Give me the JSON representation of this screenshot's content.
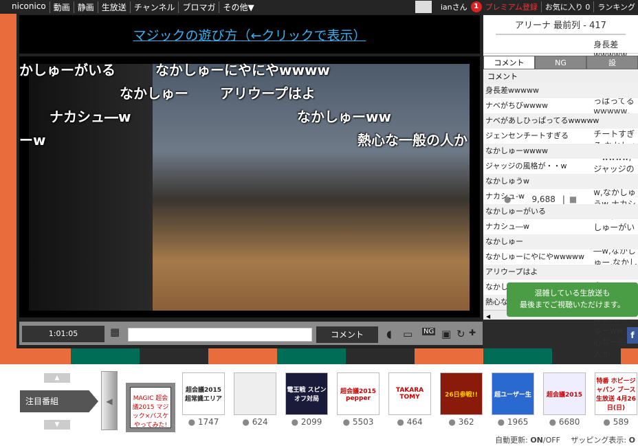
{
  "topbar": {
    "nav": [
      "niconico",
      "動画",
      "静画",
      "生放送",
      "チャンネル",
      "ブロマガ",
      "その他▼"
    ],
    "user": "ianさん",
    "notifications": "1",
    "premium": "プレミアム登録",
    "favorites": "お気に入り 0",
    "ranking": "ランキング"
  },
  "player": {
    "title_link": "マジックの遊び方（←クリックで表示）",
    "time": "1:01:05",
    "comment_placeholder": "",
    "comment_button": "コメント",
    "overlay_comments": [
      "かしゅーがいる",
      "なかしゅーにやにやwwww",
      "なかしゅー",
      "アリウープはよ",
      "ナカシュ―w",
      "なかしゅーww",
      "ーw",
      "熱心な一般の人か"
    ]
  },
  "side": {
    "seat": "アリーナ 最前列 - 417",
    "viewers": "9,688",
    "comments": [
      "身長差wwwww",
      "ナベがちびwwww",
      "ナベがあしひっぱってるwwwww",
      "ジェンセンチートすぎる",
      "なかしゅーwwww",
      "ジャッジの風格が・・w",
      "なかしゅうw",
      "ナカシュ-w",
      "なかしゅーがいる",
      "ナカシュ―w",
      "なかしゅー",
      "なかしゅーにやにやwwwww",
      "アリウープはよ",
      "なかしゅーww",
      "熱心な一般の人か"
    ],
    "tabs": [
      "コメント",
      "NG",
      "設"
    ],
    "list_header": "コメント",
    "toast": [
      "混雑している生放送も",
      "最後までご視聴いただけます。"
    ]
  },
  "colors": {
    "orange": "#e96d3c",
    "green": "#006e56",
    "dark": "#2b2b2b",
    "link": "#3ab0f0"
  },
  "bottom": {
    "featured_label": "注目番組",
    "selected_thumb": "MAGIC 超会議2015 マジック×バスケ やってみた!",
    "programs": [
      {
        "thumb": "超会議2015 超常識エリア",
        "count": "1747"
      },
      {
        "thumb": "",
        "count": "624"
      },
      {
        "thumb": "電王戦 スピンオフ対局",
        "count": "2099"
      },
      {
        "thumb": "超会議2015 pepper",
        "count": "5503"
      },
      {
        "thumb": "TAKARA TOMY",
        "count": "464"
      },
      {
        "thumb": "26日参戦!!",
        "count": "362"
      },
      {
        "thumb": "超ユーザー生",
        "count": "1965"
      },
      {
        "thumb": "超会議2015",
        "count": "6680"
      },
      {
        "thumb": "特番 ホビージャパン ブース生放送 4月26日(日)",
        "count": "589"
      }
    ],
    "auto_update_label": "自動更新:",
    "on": "ON",
    "off": "/OFF",
    "zapping_label": "ザッピング表示:",
    "zapping_value": "O"
  }
}
